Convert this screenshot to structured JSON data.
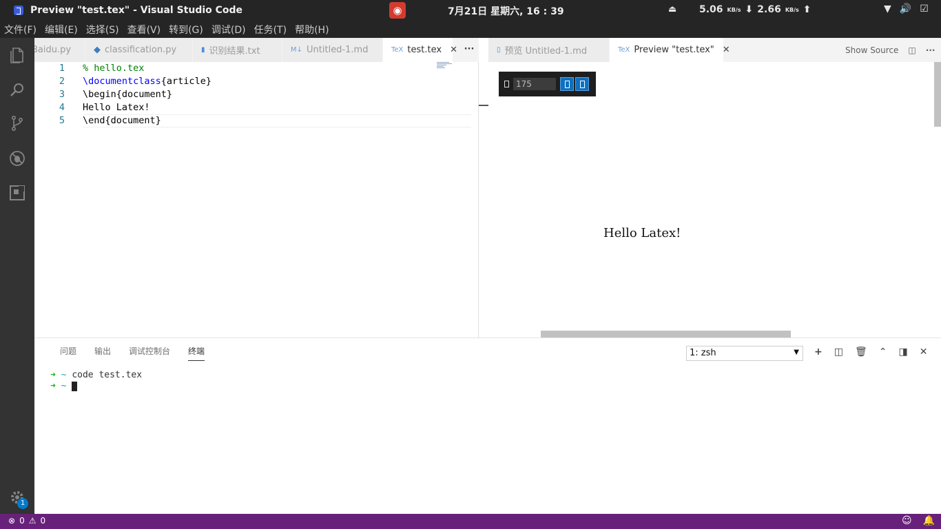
{
  "system_bar": {
    "window_title": "Preview \"test.tex\" - Visual Studio Code",
    "clock": "7月21日 星期六, 16 : 39",
    "download_speed": "5.06",
    "upload_speed": "2.66",
    "speed_unit": "KB/s"
  },
  "menu": [
    "文件(F)",
    "编辑(E)",
    "选择(S)",
    "查看(V)",
    "转到(G)",
    "调试(D)",
    "任务(T)",
    "帮助(H)"
  ],
  "left_tabs": [
    {
      "label": "Baidu.py"
    },
    {
      "label": "classification.py"
    },
    {
      "label": "识别结果.txt"
    },
    {
      "label": "Untitled-1.md"
    },
    {
      "label": "test.tex"
    }
  ],
  "right_tabs": [
    {
      "label": "预览 Untitled-1.md"
    },
    {
      "label": "Preview \"test.tex\""
    }
  ],
  "right_actions": {
    "show_source": "Show Source"
  },
  "editor": {
    "line_numbers": [
      "1",
      "2",
      "3",
      "4",
      "5"
    ],
    "lines": {
      "l1": "% hello.tex",
      "l2_cmd": "\\documentclass",
      "l2_arg": "{article}",
      "l3": "\\begin{document}",
      "l4": "Hello Latex!",
      "l5": "\\end{document}"
    }
  },
  "preview": {
    "zoom_value": "175",
    "text": "Hello Latex!"
  },
  "panel": {
    "tabs": [
      "问题",
      "输出",
      "调试控制台",
      "终端"
    ],
    "terminal_select": "1: zsh",
    "terminal": {
      "prompt_arrow": "➜",
      "prompt_dir": "~",
      "command": "code test.tex"
    }
  },
  "status_bar": {
    "errors": "0",
    "warnings": "0"
  },
  "activity": {
    "settings_badge": "1"
  },
  "colors": {
    "status_bar": "#68217a",
    "accent": "#007acc"
  }
}
